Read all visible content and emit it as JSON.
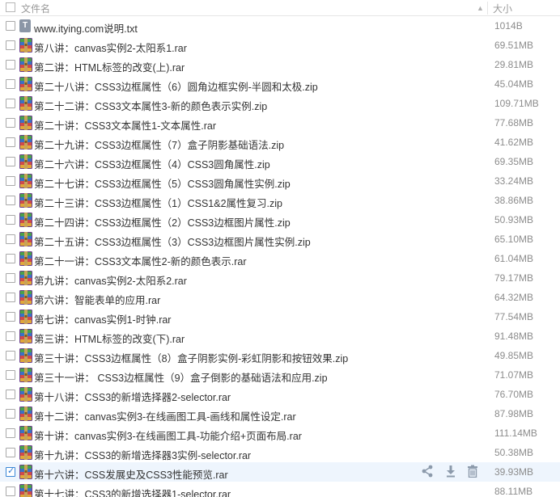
{
  "header": {
    "name_label": "文件名",
    "size_label": "大小",
    "sort_icon": "chevron-up-icon"
  },
  "files": [
    {
      "name": "www.itying.com说明.txt",
      "size": "1014B",
      "type": "txt"
    },
    {
      "name": "第八讲：canvas实例2-太阳系1.rar",
      "size": "69.51MB",
      "type": "archive"
    },
    {
      "name": "第二讲：HTML标签的改变(上).rar",
      "size": "29.81MB",
      "type": "archive"
    },
    {
      "name": "第二十八讲：CSS3边框属性（6）圆角边框实例-半圆和太极.zip",
      "size": "45.04MB",
      "type": "archive"
    },
    {
      "name": "第二十二讲：CSS3文本属性3-新的颜色表示实例.zip",
      "size": "109.71MB",
      "type": "archive"
    },
    {
      "name": "第二十讲：CSS3文本属性1-文本属性.rar",
      "size": "77.68MB",
      "type": "archive"
    },
    {
      "name": "第二十九讲：CSS3边框属性（7）盒子阴影基础语法.zip",
      "size": "41.62MB",
      "type": "archive"
    },
    {
      "name": "第二十六讲：CSS3边框属性（4）CSS3圆角属性.zip",
      "size": "69.35MB",
      "type": "archive"
    },
    {
      "name": "第二十七讲：CSS3边框属性（5）CSS3圆角属性实例.zip",
      "size": "33.24MB",
      "type": "archive"
    },
    {
      "name": "第二十三讲：CSS3边框属性（1）CSS1&2属性复习.zip",
      "size": "38.86MB",
      "type": "archive"
    },
    {
      "name": "第二十四讲：CSS3边框属性（2）CSS3边框图片属性.zip",
      "size": "50.93MB",
      "type": "archive"
    },
    {
      "name": "第二十五讲：CSS3边框属性（3）CSS3边框图片属性实例.zip",
      "size": "65.10MB",
      "type": "archive"
    },
    {
      "name": "第二十一讲：CSS3文本属性2-新的颜色表示.rar",
      "size": "61.04MB",
      "type": "archive"
    },
    {
      "name": "第九讲：canvas实例2-太阳系2.rar",
      "size": "79.17MB",
      "type": "archive"
    },
    {
      "name": "第六讲：智能表单的应用.rar",
      "size": "64.32MB",
      "type": "archive"
    },
    {
      "name": "第七讲：canvas实例1-时钟.rar",
      "size": "77.54MB",
      "type": "archive"
    },
    {
      "name": "第三讲：HTML标签的改变(下).rar",
      "size": "91.48MB",
      "type": "archive"
    },
    {
      "name": "第三十讲：CSS3边框属性（8）盒子阴影实例-彩虹阴影和按钮效果.zip",
      "size": "49.85MB",
      "type": "archive"
    },
    {
      "name": "第三十一讲： CSS3边框属性（9）盒子倒影的基础语法和应用.zip",
      "size": "71.07MB",
      "type": "archive"
    },
    {
      "name": "第十八讲：CSS3的新增选择器2-selector.rar",
      "size": "76.70MB",
      "type": "archive"
    },
    {
      "name": "第十二讲：canvas实例3-在线画图工具-画线和属性设定.rar",
      "size": "87.98MB",
      "type": "archive"
    },
    {
      "name": "第十讲：canvas实例3-在线画图工具-功能介绍+页面布局.rar",
      "size": "111.14MB",
      "type": "archive"
    },
    {
      "name": "第十九讲：CSS3的新增选择器3实例-selector.rar",
      "size": "50.38MB",
      "type": "archive"
    },
    {
      "name": "第十六讲：CSS发展史及CSS3性能预览.rar",
      "size": "39.93MB",
      "type": "archive",
      "selected": true
    },
    {
      "name": "第十七讲：CSS3的新增选择器1-selector.rar",
      "size": "88.11MB",
      "type": "archive"
    }
  ],
  "row_actions": [
    "share-icon",
    "download-icon",
    "delete-icon"
  ],
  "colors": {
    "selected_row_bg": "#eef5fd",
    "accent": "#3a87d6",
    "action_icon": "#8c9aab"
  }
}
